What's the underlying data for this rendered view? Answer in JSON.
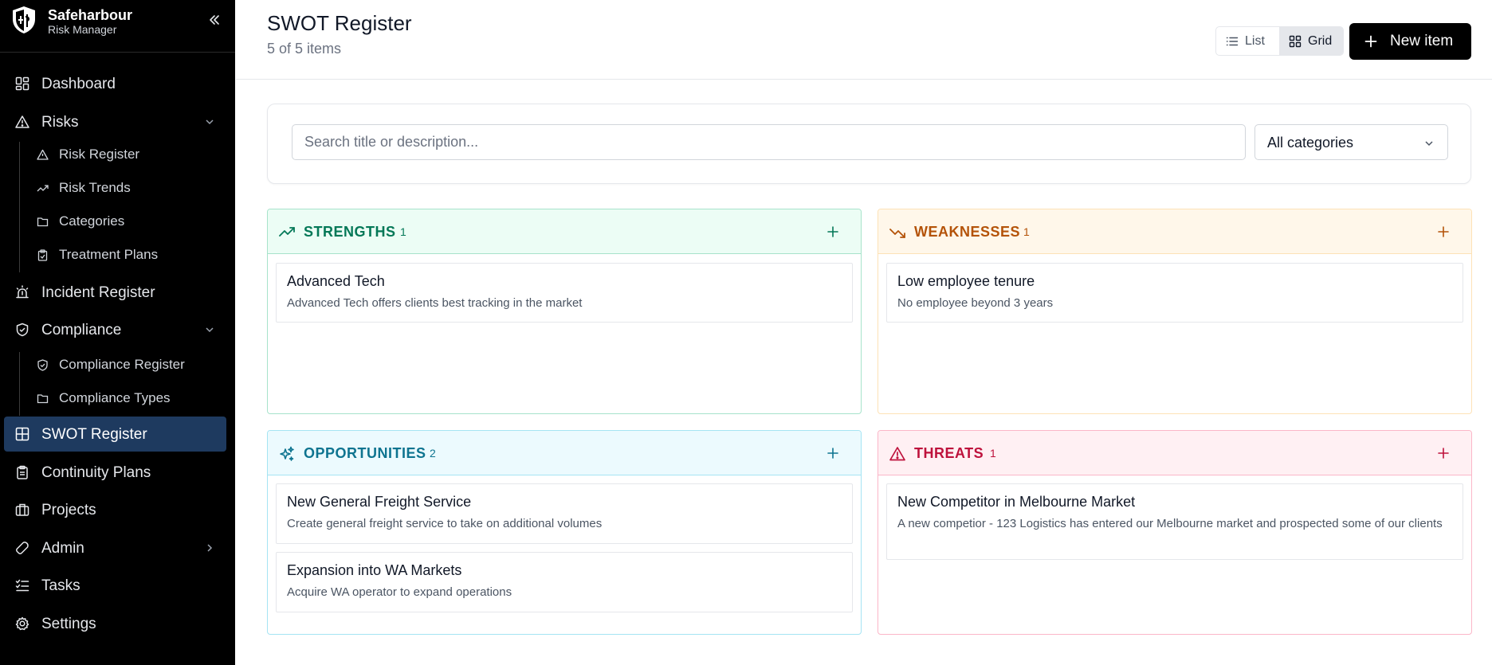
{
  "brand": {
    "name": "Safeharbour",
    "subtitle": "Risk Manager"
  },
  "sidebar": {
    "items": [
      {
        "label": "Dashboard",
        "icon": "dashboard-icon"
      },
      {
        "label": "Risks",
        "icon": "warning-triangle-icon",
        "expanded": true,
        "children": [
          {
            "label": "Risk Register",
            "icon": "warning-triangle-icon"
          },
          {
            "label": "Risk Trends",
            "icon": "trend-up-icon"
          },
          {
            "label": "Categories",
            "icon": "folder-icon"
          },
          {
            "label": "Treatment Plans",
            "icon": "clipboard-check-icon"
          }
        ]
      },
      {
        "label": "Incident Register",
        "icon": "siren-icon"
      },
      {
        "label": "Compliance",
        "icon": "shield-check-icon",
        "expanded": true,
        "children": [
          {
            "label": "Compliance Register",
            "icon": "shield-check-icon"
          },
          {
            "label": "Compliance Types",
            "icon": "folder-icon"
          }
        ]
      },
      {
        "label": "SWOT Register",
        "icon": "grid-icon",
        "active": true
      },
      {
        "label": "Continuity Plans",
        "icon": "clipboard-icon"
      },
      {
        "label": "Projects",
        "icon": "briefcase-icon"
      },
      {
        "label": "Admin",
        "icon": "wrench-icon"
      },
      {
        "label": "Tasks",
        "icon": "checklist-icon"
      },
      {
        "label": "Settings",
        "icon": "gear-icon"
      }
    ]
  },
  "header": {
    "title": "SWOT Register",
    "count": "5 of 5 items",
    "view_list": "List",
    "view_grid": "Grid",
    "active_view": "Grid",
    "new_item": "New item"
  },
  "filters": {
    "search_placeholder": "Search title or description...",
    "category": "All categories"
  },
  "quadrants": {
    "strengths": {
      "title": "STRENGTHS",
      "count": "1",
      "color": "#047857",
      "items": [
        {
          "title": "Advanced Tech",
          "description": "Advanced Tech offers clients best tracking in the market"
        }
      ]
    },
    "weaknesses": {
      "title": "WEAKNESSES",
      "count": "1",
      "color": "#b45309",
      "items": [
        {
          "title": "Low employee tenure",
          "description": "No employee beyond 3 years"
        }
      ]
    },
    "opportunities": {
      "title": "OPPORTUNITIES",
      "count": "2",
      "color": "#0e7490",
      "items": [
        {
          "title": "New General Freight Service",
          "description": "Create general freight service to take on additional volumes"
        },
        {
          "title": "Expansion into WA Markets",
          "description": "Acquire WA operator to expand operations"
        }
      ]
    },
    "threats": {
      "title": "THREATS",
      "count": "1",
      "color": "#be123c",
      "items": [
        {
          "title": "New Competitor in Melbourne Market",
          "description": "A new competior - 123 Logistics has entered our Melbourne market and prospected some of our clients"
        }
      ]
    }
  }
}
